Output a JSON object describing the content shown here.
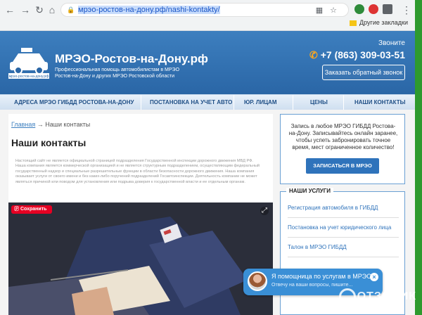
{
  "browser": {
    "url_prefix": "мрэо-ростов-на-дону.рф/",
    "url_path": "nashi-kontakty/",
    "bookmarks_label": "Другие закладки"
  },
  "header": {
    "site_title": "МРЭО-Ростов-на-Дону.рф",
    "tagline": "Профессиональная помощь автомобилистам в МРЭО Ростов-на-Дону и других МРЭО Ростовской области",
    "logo_caption": "мрэо-ростов-на-дону.рф",
    "call_label": "Звоните",
    "phone": "+7 (863) 309-03-51",
    "callback_button": "Заказать обратный звонок"
  },
  "menu": {
    "items": [
      {
        "label": "АДРЕСА МРЭО ГИБДД РОСТОВА-НА-ДОНУ"
      },
      {
        "label": "ПОСТАНОВКА НА УЧЕТ АВТО"
      },
      {
        "label": "ЮР. ЛИЦАМ"
      },
      {
        "label": "ЦЕНЫ"
      },
      {
        "label": "НАШИ КОНТАКТЫ"
      }
    ]
  },
  "breadcrumb": {
    "home": "Главная",
    "separator": "→",
    "current": "Наши контакты"
  },
  "main": {
    "title": "Наши контакты",
    "disclaimer": "Настоящий сайт не является официальной страницей подразделения Государственной инспекции дорожного движения МВД РФ. Наша компания является коммерческой организацией и не является структурным подразделением, осуществляющим федеральный государственный надзор и специальные разрешительные функции в области безопасности дорожного движения. Наша компания оказывает услуги от своего имени и без каких-либо поручений подразделений Госавтоинспекции. Деятельность компании не может являться причиной или поводом для установления или подрыва доверия к государственной власти и ее отдельным органам.",
    "pinterest_save": "Сохранить"
  },
  "sidebar": {
    "signup_text": "Запись в любое МРЭО ГИБДД Ростова-на-Дону. Записывайтесь онлайн заранее, чтобы успеть забронировать точное время, мест ограниченное количество!",
    "signup_button": "ЗАПИСАТЬСЯ В МРЭО",
    "services_title": "НАШИ УСЛУГИ",
    "services": [
      {
        "label": "Регистрация автомобиля в ГИБДД"
      },
      {
        "label": "Постановка на учет юридического лица"
      },
      {
        "label": "Талон в МРЭО ГИБДД"
      }
    ]
  },
  "chat": {
    "title": "Я помощница по услугам в МРЭО",
    "subtitle": "Отвечу на ваши вопросы, пишите..."
  },
  "watermark": "ОТЗОВИК",
  "colors": {
    "header_blue": "#2a66a6",
    "accent_blue": "#2f73bb",
    "phone_icon": "#f5a623",
    "pinterest_red": "#e60023"
  }
}
